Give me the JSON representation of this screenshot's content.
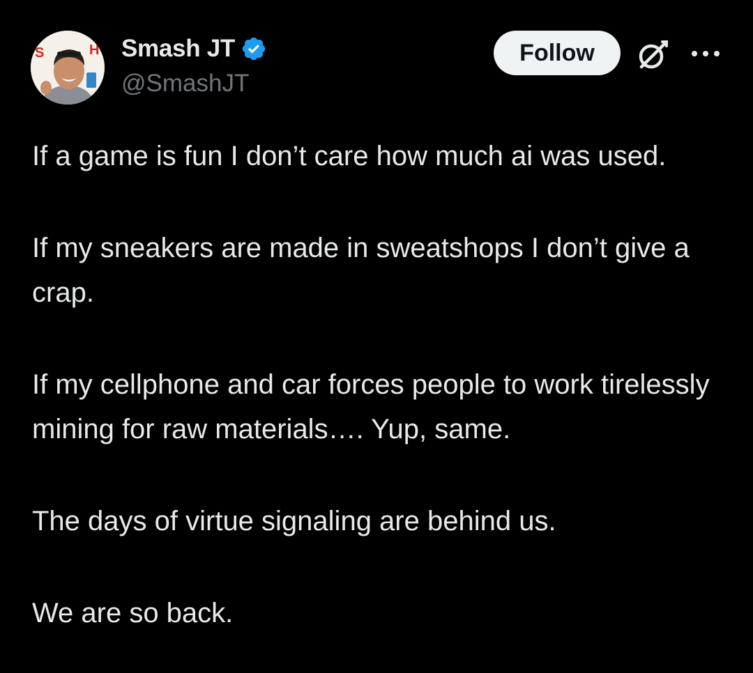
{
  "user": {
    "display_name": "Smash JT",
    "handle": "@SmashJT",
    "verified": true,
    "avatar_text": "SMASH"
  },
  "actions": {
    "follow_label": "Follow"
  },
  "icons": {
    "verified": "verified-badge-icon",
    "grok": "grok-icon",
    "more": "more-options-icon"
  },
  "colors": {
    "background": "#000000",
    "text": "#e7e9ea",
    "secondary_text": "#71767b",
    "verified_blue": "#1d9bf0",
    "follow_bg": "#eff3f4"
  },
  "tweet": {
    "paragraphs": [
      "If a game is fun I don’t care how much ai was used.",
      "If my sneakers are made in sweatshops I don’t give a crap.",
      "If my cellphone and car forces people to work tirelessly mining for raw materials…. Yup, same.",
      "The days of virtue signaling are behind us.",
      "We are so back."
    ]
  }
}
